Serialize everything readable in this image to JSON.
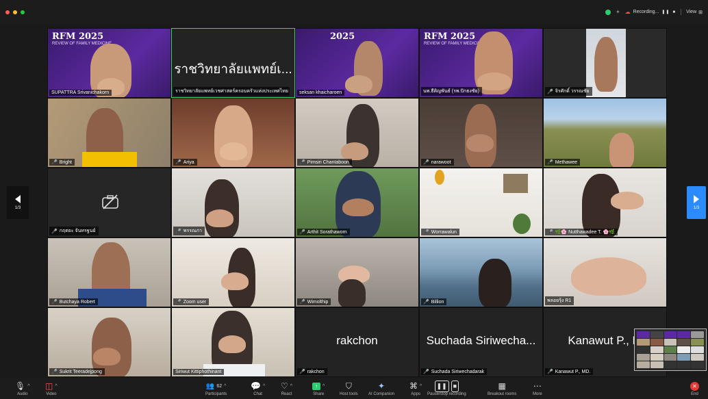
{
  "colors": {
    "accent_blue": "#2a8cff",
    "active_speaker_green": "#3fd36b",
    "mic_muted_red": "#ff4d4d",
    "end_red": "#e53935",
    "traffic_red": "#ff5f57",
    "traffic_yellow": "#febc2e",
    "traffic_green": "#28c840"
  },
  "topbar": {
    "recording_label": "Recording...",
    "pause_icon": "pause-icon",
    "stop_icon": "stop-icon",
    "view_label": "View",
    "view_icon": "grid-icon"
  },
  "banner": {
    "logo_text": "RFM",
    "year": "2025"
  },
  "participants": [
    {
      "name": "SUPATTRA Srivanichakorn",
      "muted": false,
      "type": "banner-video"
    },
    {
      "name": "ราชวิทยาลัยแพทย์เวชศาสตร์ครอบครัวแห่งประเทศไทย",
      "display": "ราชวิทยาลัยแพทย์เ...",
      "muted": false,
      "type": "name-only",
      "active": true
    },
    {
      "name": "seksan khaicharoen",
      "muted": false,
      "type": "banner-video"
    },
    {
      "name": "นพ.ธีติญพันธ์ (รพ.ปักธงชัย)",
      "muted": false,
      "type": "banner-video"
    },
    {
      "name": "จิรศักดิ์ วรรณชัย",
      "muted": true,
      "type": "video"
    },
    {
      "name": "Bright",
      "muted": true,
      "type": "video"
    },
    {
      "name": "Ariya",
      "muted": true,
      "type": "video"
    },
    {
      "name": "Pimsiri Chantaboon",
      "muted": true,
      "type": "video"
    },
    {
      "name": "narawoot",
      "muted": true,
      "type": "video"
    },
    {
      "name": "Methawee",
      "muted": true,
      "type": "video"
    },
    {
      "name": "กฤตยะ จันทรฐนย์",
      "muted": true,
      "type": "camera-off"
    },
    {
      "name": "พรรณภา",
      "muted": true,
      "type": "video"
    },
    {
      "name": "Arthit Sorathaworn",
      "muted": true,
      "type": "video"
    },
    {
      "name": "Worrawalun",
      "muted": true,
      "type": "video"
    },
    {
      "name": "🌿🌸 Nutthawadee T. 🌸🌿",
      "muted": true,
      "type": "video"
    },
    {
      "name": "Butchaya Robert",
      "muted": true,
      "type": "video"
    },
    {
      "name": "Zoom user",
      "muted": true,
      "type": "video"
    },
    {
      "name": "Wimolthip",
      "muted": true,
      "type": "video"
    },
    {
      "name": "Billion",
      "muted": true,
      "type": "video"
    },
    {
      "name": "พลอยรุ้ง R1",
      "muted": false,
      "type": "video"
    },
    {
      "name": "Sukrit Teeradejpong",
      "muted": true,
      "type": "video"
    },
    {
      "name": "Siriwut Kittiphothinant",
      "muted": false,
      "type": "video"
    },
    {
      "name": "rakchon",
      "display": "rakchon",
      "muted": true,
      "type": "name-only"
    },
    {
      "name": "Suchada Siriwechadarak",
      "display": "Suchada Siriwecha...",
      "muted": true,
      "type": "name-only"
    },
    {
      "name": "Kanawut P., MD.",
      "display": "Kanawut P., M",
      "muted": true,
      "type": "name-only"
    }
  ],
  "paging": {
    "left_label": "1/3",
    "right_label": "1/3"
  },
  "toolbar": {
    "audio": "Audio",
    "video": "Video",
    "participants": "Participants",
    "participants_count": "62",
    "chat": "Chat",
    "react": "React",
    "share": "Share",
    "host_tools": "Host tools",
    "ai_companion": "AI Companion",
    "apps": "Apps",
    "pause_recording": "Pause/stop recording",
    "breakout_rooms": "Breakout rooms",
    "more": "More",
    "end": "End"
  }
}
